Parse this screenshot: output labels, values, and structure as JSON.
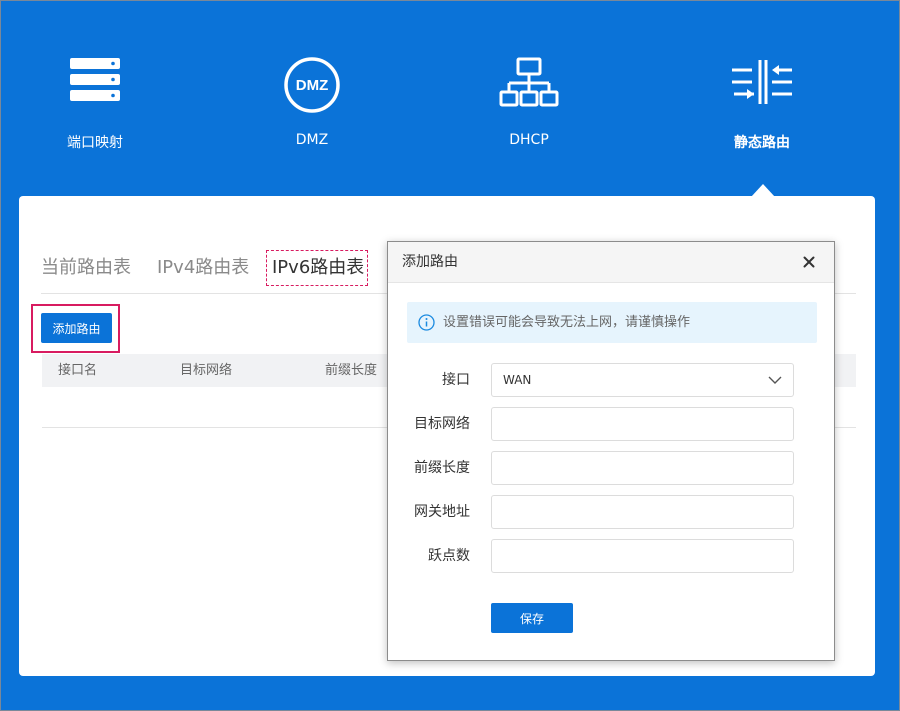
{
  "nav": {
    "items": [
      {
        "label": "端口映射",
        "icon": "server-icon"
      },
      {
        "label": "DMZ",
        "icon": "dmz-icon"
      },
      {
        "label": "DHCP",
        "icon": "network-tree-icon"
      },
      {
        "label": "静态路由",
        "icon": "static-route-icon",
        "active": true
      }
    ]
  },
  "tabs": [
    {
      "label": "当前路由表"
    },
    {
      "label": "IPv4路由表"
    },
    {
      "label": "IPv6路由表",
      "active": true
    }
  ],
  "toolbar": {
    "add_label": "添加路由"
  },
  "table": {
    "columns": [
      "接口名",
      "目标网络",
      "前缀长度"
    ]
  },
  "modal": {
    "title": "添加路由",
    "alert": "设置错误可能会导致无法上网，请谨慎操作",
    "fields": {
      "interface": {
        "label": "接口",
        "value": "WAN"
      },
      "target_network": {
        "label": "目标网络",
        "value": ""
      },
      "prefix_length": {
        "label": "前缀长度",
        "value": ""
      },
      "gateway": {
        "label": "网关地址",
        "value": ""
      },
      "hops": {
        "label": "跃点数",
        "value": ""
      }
    },
    "save_label": "保存"
  },
  "colors": {
    "primary": "#0b73d8",
    "highlight": "#d81b60",
    "alert_bg": "#e6f4fd"
  }
}
